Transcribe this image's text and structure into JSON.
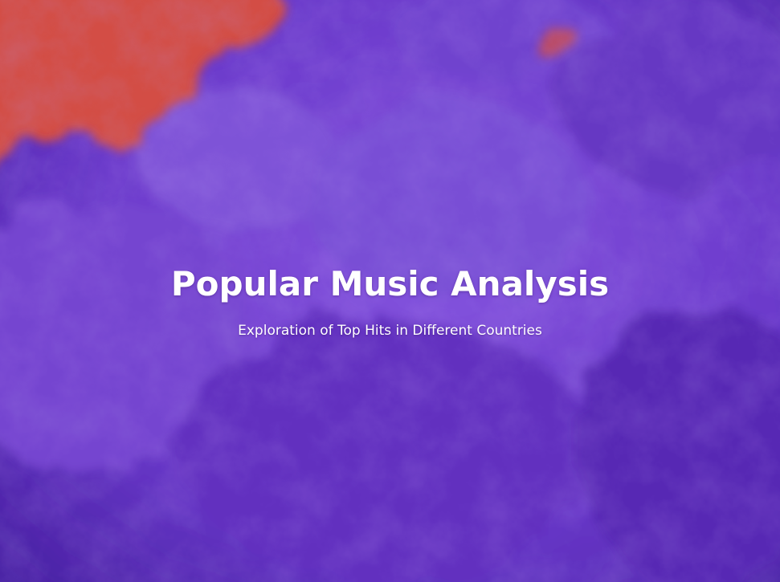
{
  "hero": {
    "title": "Popular Music Analysis",
    "subtitle": "Exploration of Top Hits in Different Countries",
    "background_image": "purple-smoke-over-orange-background"
  },
  "colors": {
    "smoke_purple": "#7a48d6",
    "smoke_dark": "#4a20a8",
    "background_orange": "#e0523f",
    "text": "#ffffff"
  }
}
